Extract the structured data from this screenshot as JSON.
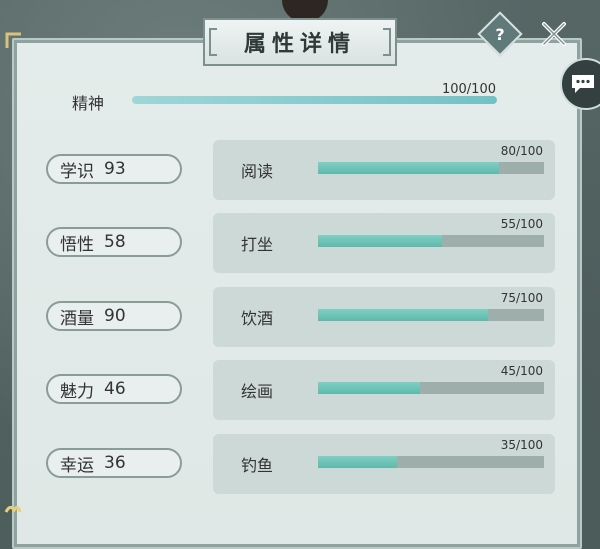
{
  "title": "属性详情",
  "help_label": "?",
  "spirit": {
    "label": "精神",
    "value_text": "100/100",
    "fraction": 1.0
  },
  "attributes": [
    {
      "name": "学识",
      "value": "93",
      "activity": "阅读",
      "count_text": "80/100",
      "fraction": 0.8
    },
    {
      "name": "悟性",
      "value": "58",
      "activity": "打坐",
      "count_text": "55/100",
      "fraction": 0.55
    },
    {
      "name": "酒量",
      "value": "90",
      "activity": "饮酒",
      "count_text": "75/100",
      "fraction": 0.75
    },
    {
      "name": "魅力",
      "value": "46",
      "activity": "绘画",
      "count_text": "45/100",
      "fraction": 0.45
    },
    {
      "name": "幸运",
      "value": "36",
      "activity": "钓鱼",
      "count_text": "35/100",
      "fraction": 0.35
    }
  ],
  "icons": {
    "help": "question-icon",
    "close": "close-icon",
    "chat": "chat-bubble-icon"
  },
  "colors": {
    "accent": "#74c1c5",
    "bar_fill": "#5fb8ab",
    "bar_track": "#9eaeab"
  }
}
